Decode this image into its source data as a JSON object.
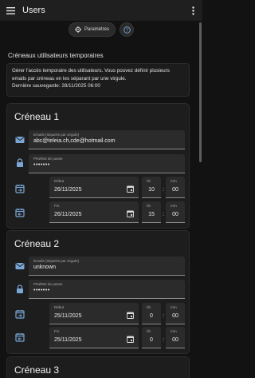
{
  "appbar": {
    "title": "Users",
    "menu_icon": "hamburger-icon",
    "more_icon": "more-vert-icon"
  },
  "header": {
    "settings_label": "Paramètres",
    "settings_icon": "gear-icon",
    "help_icon": "help-icon"
  },
  "section_title": "Créneaux utilisateurs temporaires",
  "info": {
    "text": "Gérer l'accès temporaire des utilisateurs. Vous pouvez définir plusieurs emails par créneau en les séparant par une virgule.",
    "saved": "Dernière sauvegarde: 28/11/2025 06:00"
  },
  "slots": [
    {
      "title": "Créneau 1",
      "emails_label": "Emails (séparés par virgule)",
      "emails_value": "abc@teleia.ch,cde@hotmail.com",
      "pin_label": "PIN/Mot de passe",
      "pin_value": "•••••••",
      "start": {
        "label": "Début",
        "date": "26/11/2025",
        "hh_label": "hh",
        "mm_label": "mm",
        "hh": "10",
        "mm": "00"
      },
      "end": {
        "label": "Fin",
        "date": "26/11/2025",
        "hh_label": "hh",
        "mm_label": "mm",
        "hh": "15",
        "mm": "00"
      }
    },
    {
      "title": "Créneau 2",
      "emails_label": "Emails (séparés par virgule)",
      "emails_value": "unknown",
      "pin_label": "PIN/Mot de passe",
      "pin_value": "•••••••",
      "start": {
        "label": "Début",
        "date": "25/11/2025",
        "hh_label": "hh",
        "mm_label": "mm",
        "hh": "0",
        "mm": "00"
      },
      "end": {
        "label": "Fin",
        "date": "25/11/2025",
        "hh_label": "hh",
        "mm_label": "mm",
        "hh": "0",
        "mm": "00"
      }
    },
    {
      "title": "Créneau 3"
    }
  ],
  "colon": ":",
  "colors": {
    "background": "#121212",
    "card": "#1d1d1d",
    "field": "#2b2b2b",
    "icon_blue": "#7aa7d6",
    "appbar": "#1f1f1f"
  }
}
